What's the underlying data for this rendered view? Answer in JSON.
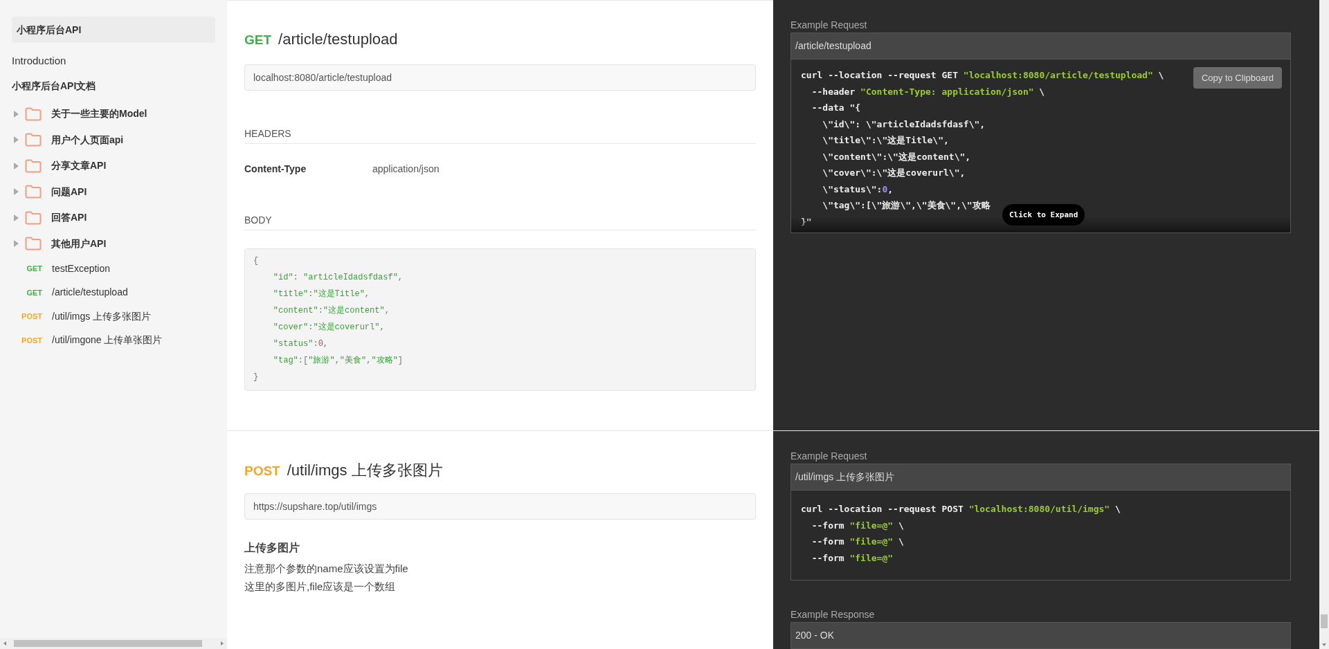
{
  "sidebar": {
    "title": "小程序后台API",
    "intro": "Introduction",
    "collection": "小程序后台API文档",
    "items": [
      {
        "kind": "folder",
        "label": "关于一些主要的Model",
        "expanded": false
      },
      {
        "kind": "folder",
        "label": "用户个人页面api",
        "expanded": false
      },
      {
        "kind": "folder",
        "label": "分享文章API",
        "expanded": false
      },
      {
        "kind": "folder",
        "label": "问题API",
        "expanded": false
      },
      {
        "kind": "folder",
        "label": "回答API",
        "expanded": false
      },
      {
        "kind": "folder",
        "label": "其他用户API",
        "expanded": false
      },
      {
        "kind": "request",
        "method": "GET",
        "color": "#3cb043",
        "label": "testException"
      },
      {
        "kind": "request",
        "method": "GET",
        "color": "#3cb043",
        "label": "/article/testupload"
      },
      {
        "kind": "request",
        "method": "POST",
        "color": "#f5a623",
        "label": "/util/imgs 上传多张图片"
      },
      {
        "kind": "request",
        "method": "POST",
        "color": "#f5a623",
        "label": "/util/imgone 上传单张图片"
      }
    ]
  },
  "sections": [
    {
      "method": "GET",
      "color": "#3cb043",
      "path": "/article/testupload",
      "url": "localhost:8080/article/testupload",
      "headers_title": "HEADERS",
      "headers": [
        {
          "key": "Content-Type",
          "value": "application/json"
        }
      ],
      "body_title": "BODY",
      "body_lines": [
        [
          {
            "kind": "punct",
            "text": "{"
          }
        ],
        [
          {
            "kind": "string",
            "text": "    \"id\""
          },
          {
            "kind": "punct",
            "text": ": "
          },
          {
            "kind": "string",
            "text": "\"articleIdadsfdasf\""
          },
          {
            "kind": "punct",
            "text": ","
          }
        ],
        [
          {
            "kind": "string",
            "text": "    \"title\""
          },
          {
            "kind": "punct",
            "text": ":"
          },
          {
            "kind": "string",
            "text": "\"这是Title\""
          },
          {
            "kind": "punct",
            "text": ","
          }
        ],
        [
          {
            "kind": "string",
            "text": "    \"content\""
          },
          {
            "kind": "punct",
            "text": ":"
          },
          {
            "kind": "string",
            "text": "\"这是content\""
          },
          {
            "kind": "punct",
            "text": ","
          }
        ],
        [
          {
            "kind": "string",
            "text": "    \"cover\""
          },
          {
            "kind": "punct",
            "text": ":"
          },
          {
            "kind": "string",
            "text": "\"这是coverurl\""
          },
          {
            "kind": "punct",
            "text": ","
          }
        ],
        [
          {
            "kind": "string",
            "text": "    \"status\""
          },
          {
            "kind": "punct",
            "text": ":"
          },
          {
            "kind": "number",
            "text": "0"
          },
          {
            "kind": "punct",
            "text": ","
          }
        ],
        [
          {
            "kind": "string",
            "text": "    \"tag\""
          },
          {
            "kind": "punct",
            "text": ":["
          },
          {
            "kind": "string",
            "text": "\"旅游\""
          },
          {
            "kind": "punct",
            "text": ","
          },
          {
            "kind": "string",
            "text": "\"美食\""
          },
          {
            "kind": "punct",
            "text": ","
          },
          {
            "kind": "string",
            "text": "\"攻略\""
          },
          {
            "kind": "punct",
            "text": "]"
          }
        ],
        [
          {
            "kind": "punct",
            "text": "}"
          }
        ]
      ],
      "example": {
        "label": "Example Request",
        "title": "/article/testupload",
        "copy_button": "Copy to Clipboard",
        "expand_button": "Click to Expand",
        "code_lines": [
          [
            {
              "kind": "plain",
              "text": "curl --location --request GET "
            },
            {
              "kind": "string",
              "text": "\"localhost:8080/article/testupload\""
            },
            {
              "kind": "plain",
              "text": " \\"
            }
          ],
          [
            {
              "kind": "plain",
              "text": "  --header "
            },
            {
              "kind": "string",
              "text": "\"Content-Type: application/json\""
            },
            {
              "kind": "plain",
              "text": " \\"
            }
          ],
          [
            {
              "kind": "plain",
              "text": "  --data \"{"
            }
          ],
          [
            {
              "kind": "plain",
              "text": "    \\\"id\\\": \\\"articleIdadsfdasf\\\","
            }
          ],
          [
            {
              "kind": "plain",
              "text": "    \\\"title\\\":\\\"这是Title\\\","
            }
          ],
          [
            {
              "kind": "plain",
              "text": "    \\\"content\\\":\\\"这是content\\\","
            }
          ],
          [
            {
              "kind": "plain",
              "text": "    \\\"cover\\\":\\\"这是coverurl\\\","
            }
          ],
          [
            {
              "kind": "plain",
              "text": "    \\\"status\\\":"
            },
            {
              "kind": "number",
              "text": "0"
            },
            {
              "kind": "plain",
              "text": ","
            }
          ],
          [
            {
              "kind": "plain",
              "text": "    \\\"tag\\\":[\\\"旅游\\\",\\\"美食\\\",\\\"攻略"
            }
          ],
          [
            {
              "kind": "plain",
              "text": "}\""
            }
          ]
        ]
      }
    },
    {
      "method": "POST",
      "color": "#f5a623",
      "path": "/util/imgs 上传多张图片",
      "url": "https://supshare.top/util/imgs",
      "description_title": "上传多图片",
      "description_lines": [
        "注意那个参数的name应该设置为file",
        "这里的多图片,file应该是一个数组"
      ],
      "example": {
        "label": "Example Request",
        "title": "/util/imgs 上传多张图片",
        "code_lines": [
          [
            {
              "kind": "plain",
              "text": "curl --location --request POST "
            },
            {
              "kind": "string",
              "text": "\"localhost:8080/util/imgs\""
            },
            {
              "kind": "plain",
              "text": " \\"
            }
          ],
          [
            {
              "kind": "plain",
              "text": "  --form "
            },
            {
              "kind": "string",
              "text": "\"file=@\""
            },
            {
              "kind": "plain",
              "text": " \\"
            }
          ],
          [
            {
              "kind": "plain",
              "text": "  --form "
            },
            {
              "kind": "string",
              "text": "\"file=@\""
            },
            {
              "kind": "plain",
              "text": " \\"
            }
          ],
          [
            {
              "kind": "plain",
              "text": "  --form "
            },
            {
              "kind": "string",
              "text": "\"file=@\""
            }
          ]
        ]
      },
      "response": {
        "label": "Example Response",
        "title": "200  -  OK"
      }
    }
  ]
}
